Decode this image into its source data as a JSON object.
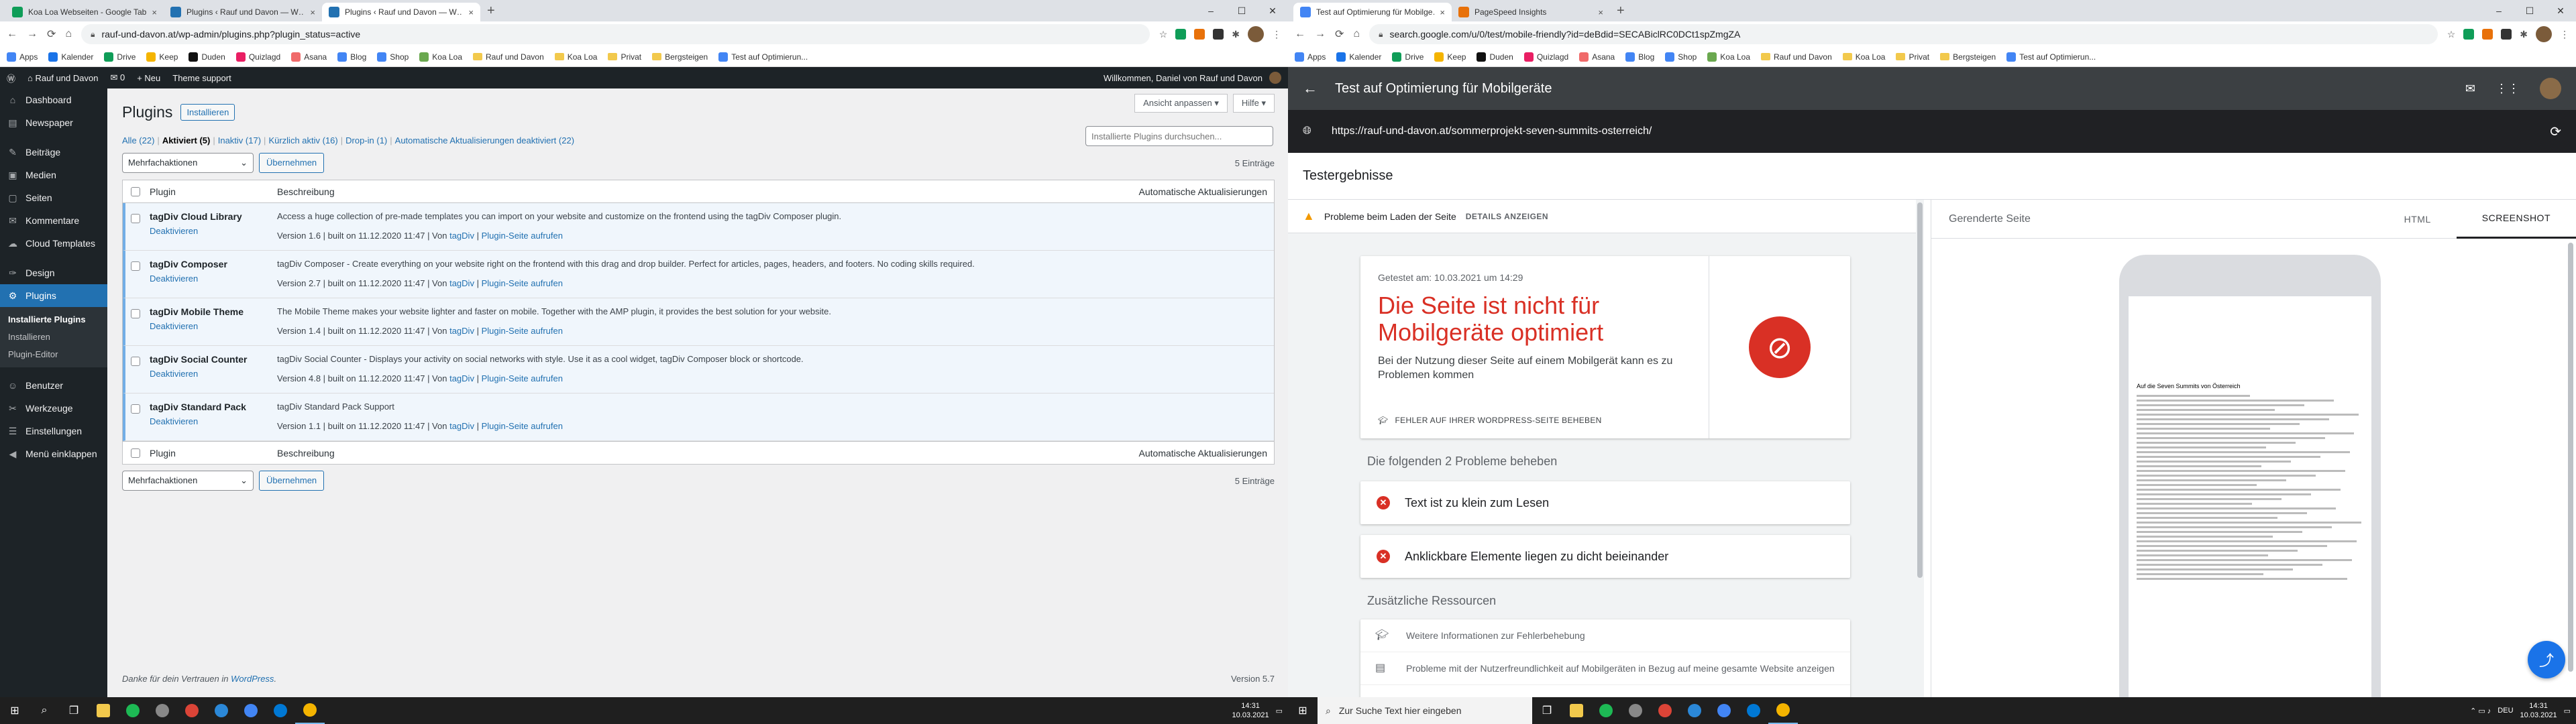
{
  "left_browser": {
    "tabs": [
      {
        "title": "Koa Loa Webseiten - Google Tab…",
        "color": "#0f9d58"
      },
      {
        "title": "Plugins ‹ Rauf und Davon — W…",
        "color": "#2271b1"
      },
      {
        "title": "Plugins ‹ Rauf und Davon — W…",
        "color": "#2271b1"
      }
    ],
    "url": "rauf-und-davon.at/wp-admin/plugins.php?plugin_status=active"
  },
  "right_browser": {
    "tabs": [
      {
        "title": "Test auf Optimierung für Mobilge…",
        "color": "#4285f4"
      },
      {
        "title": "PageSpeed Insights",
        "color": "#e8710a"
      }
    ],
    "url": "search.google.com/u/0/test/mobile-friendly?id=deBdid=SECABiclRC0DCt1spZmgZA"
  },
  "bookmarks": [
    "Apps",
    "Kalender",
    "Drive",
    "Keep",
    "Duden",
    "Quizlagd",
    "Asana",
    "Blog",
    "Shop",
    "Koa Loa",
    "Rauf und Davon",
    "Koa Loa",
    "Privat",
    "Bergsteigen",
    "Test auf Optimierun..."
  ],
  "wp": {
    "adminbar": {
      "site": "Rauf und Davon",
      "comments": "0",
      "new": "+ Neu",
      "theme_support": "Theme support",
      "greeting": "Willkommen, Daniel von Rauf und Davon"
    },
    "menu": [
      {
        "label": "Dashboard",
        "icon": "⌂"
      },
      {
        "label": "Newspaper",
        "icon": "▤"
      },
      {
        "label": "Beiträge",
        "icon": "✎"
      },
      {
        "label": "Medien",
        "icon": "▣"
      },
      {
        "label": "Seiten",
        "icon": "▢"
      },
      {
        "label": "Kommentare",
        "icon": "✉"
      },
      {
        "label": "Cloud Templates",
        "icon": "☁"
      },
      {
        "label": "Design",
        "icon": "✑"
      },
      {
        "label": "Plugins",
        "icon": "⚙"
      },
      {
        "label": "Benutzer",
        "icon": "☺"
      },
      {
        "label": "Werkzeuge",
        "icon": "✂"
      },
      {
        "label": "Einstellungen",
        "icon": "☰"
      },
      {
        "label": "Menü einklappen",
        "icon": "◀"
      }
    ],
    "submenu": [
      "Installierte Plugins",
      "Installieren",
      "Plugin-Editor"
    ],
    "screen_options": "Ansicht anpassen ▾",
    "help": "Hilfe ▾",
    "page_title": "Plugins",
    "add_new": "Installieren",
    "filters": {
      "all": "Alle (22)",
      "active": "Aktiviert (5)",
      "inactive": "Inaktiv (17)",
      "recent": "Kürzlich aktiv (16)",
      "dropin": "Drop-in (1)",
      "autoupdate": "Automatische Aktualisierungen deaktiviert (22)"
    },
    "search_placeholder": "Installierte Plugins durchsuchen...",
    "bulk_label": "Mehrfachaktionen",
    "apply": "Übernehmen",
    "count": "5 Einträge",
    "col_plugin": "Plugin",
    "col_desc": "Beschreibung",
    "col_auto": "Automatische Aktualisierungen",
    "plugins": [
      {
        "name": "tagDiv Cloud Library",
        "action": "Deaktivieren",
        "desc": "Access a huge collection of pre-made templates you can import on your website and customize on the frontend using the tagDiv Composer plugin.",
        "version": "Version 1.6 | built on 11.12.2020 11:47 | Von",
        "author": "tagDiv",
        "site": "Plugin-Seite aufrufen"
      },
      {
        "name": "tagDiv Composer",
        "action": "Deaktivieren",
        "desc": "tagDiv Composer - Create everything on your website right on the frontend with this drag and drop builder. Perfect for articles, pages, headers, and footers. No coding skills required.",
        "version": "Version 2.7 | built on 11.12.2020 11:47 | Von",
        "author": "tagDiv",
        "site": "Plugin-Seite aufrufen"
      },
      {
        "name": "tagDiv Mobile Theme",
        "action": "Deaktivieren",
        "desc": "The Mobile Theme makes your website lighter and faster on mobile. Together with the AMP plugin, it provides the best solution for your website.",
        "version": "Version 1.4 | built on 11.12.2020 11:47 | Von",
        "author": "tagDiv",
        "site": "Plugin-Seite aufrufen"
      },
      {
        "name": "tagDiv Social Counter",
        "action": "Deaktivieren",
        "desc": "tagDiv Social Counter - Displays your activity on social networks with style. Use it as a cool widget, tagDiv Composer block or shortcode.",
        "version": "Version 4.8 | built on 11.12.2020 11:47 | Von",
        "author": "tagDiv",
        "site": "Plugin-Seite aufrufen"
      },
      {
        "name": "tagDiv Standard Pack",
        "action": "Deaktivieren",
        "desc": "tagDiv Standard Pack Support",
        "version": "Version 1.1 | built on 11.12.2020 11:47 | Von",
        "author": "tagDiv",
        "site": "Plugin-Seite aufrufen"
      }
    ],
    "footer_thanks": "Danke für dein Vertrauen in",
    "footer_link": "WordPress",
    "version": "Version 5.7"
  },
  "google": {
    "title": "Test auf Optimierung für Mobilgeräte",
    "tested_url": "https://rauf-und-davon.at/sommerprojekt-seven-summits-osterreich/",
    "results_title": "Testergebnisse",
    "warning": "Probleme beim Laden der Seite",
    "details": "DETAILS ANZEIGEN",
    "tested_date": "Getestet am: 10.03.2021 um 14:29",
    "verdict": "Die Seite ist nicht für Mobilgeräte optimiert",
    "verdict_sub": "Bei der Nutzung dieser Seite auf einem Mobilgerät kann es zu Problemen kommen",
    "wp_errors": "FEHLER AUF IHRER WORDPRESS-SEITE BEHEBEN",
    "issues_title": "Die folgenden 2 Probleme beheben",
    "issues": [
      "Text ist zu klein zum Lesen",
      "Anklickbare Elemente liegen zu dicht beieinander"
    ],
    "resources_title": "Zusätzliche Ressourcen",
    "resources": [
      "Weitere Informationen zur Fehlerbehebung",
      "Probleme mit der Nutzerfreundlichkeit auf Mobilgeräten in Bezug auf meine gesamte Website anzeigen"
    ],
    "rendered": "Gerenderte Seite",
    "tab_html": "HTML",
    "tab_screenshot": "SCREENSHOT",
    "mini_heading": "Auf die Seven Summits von Österreich"
  },
  "taskbar": {
    "search_placeholder": "Zur Suche Text hier eingeben",
    "time": "14:31",
    "date": "10.03.2021",
    "lang": "DEU"
  }
}
